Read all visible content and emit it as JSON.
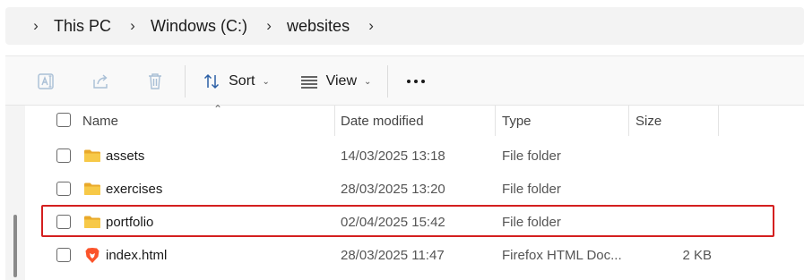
{
  "breadcrumb": {
    "items": [
      "This PC",
      "Windows (C:)",
      "websites"
    ]
  },
  "toolbar": {
    "sort_label": "Sort",
    "view_label": "View",
    "icons": {
      "rename": "rename-icon",
      "share": "share-icon",
      "delete": "trash-icon",
      "sort": "sort-icon",
      "view": "view-icon",
      "more": "more-icon"
    }
  },
  "file_list": {
    "columns": {
      "name": "Name",
      "date_modified": "Date modified",
      "type": "Type",
      "size": "Size"
    },
    "rows": [
      {
        "name": "assets",
        "date_modified": "14/03/2025 13:18",
        "type": "File folder",
        "size": "",
        "icon": "folder-icon"
      },
      {
        "name": "exercises",
        "date_modified": "28/03/2025 13:20",
        "type": "File folder",
        "size": "",
        "icon": "folder-icon"
      },
      {
        "name": "portfolio",
        "date_modified": "02/04/2025 15:42",
        "type": "File folder",
        "size": "",
        "icon": "folder-icon"
      },
      {
        "name": "index.html",
        "date_modified": "28/03/2025 11:47",
        "type": "Firefox HTML Doc...",
        "size": "2 KB",
        "icon": "brave-browser-icon"
      }
    ]
  },
  "colors": {
    "highlight": "#d41f1f",
    "folder": "#f4c24d",
    "icon_disabled": "#a9bfd6"
  }
}
